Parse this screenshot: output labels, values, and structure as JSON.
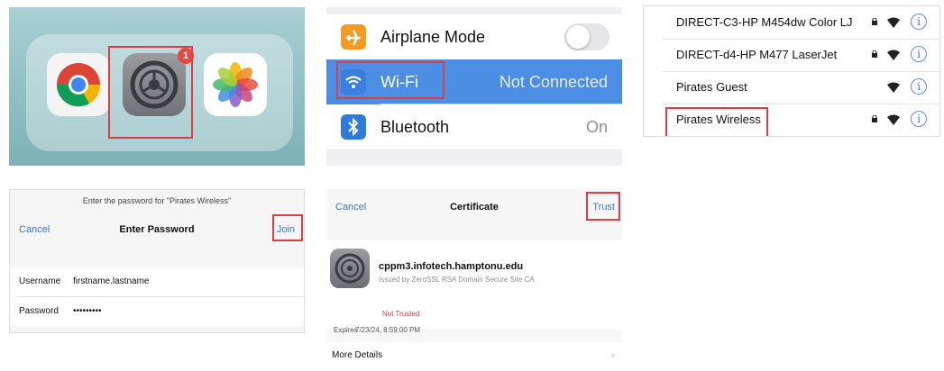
{
  "dock": {
    "badge": "1",
    "apps": [
      "chrome-icon",
      "settings-icon",
      "photos-icon"
    ]
  },
  "settings": {
    "airplane_label": "Airplane Mode",
    "wifi_label": "Wi-Fi",
    "wifi_value": "Not Connected",
    "bluetooth_label": "Bluetooth",
    "bluetooth_value": "On",
    "highlight_color": "#4d8ee5"
  },
  "networks": [
    {
      "name": "DIRECT-C3-HP M454dw Color LJ",
      "locked": true
    },
    {
      "name": "DIRECT-d4-HP M477 LaserJet",
      "locked": true
    },
    {
      "name": "Pirates Guest",
      "locked": false
    },
    {
      "name": "Pirates Wireless",
      "locked": true
    }
  ],
  "password_dialog": {
    "hint": "Enter the password for \"Pirates Wireless\"",
    "cancel": "Cancel",
    "title": "Enter Password",
    "join": "Join",
    "username_label": "Username",
    "username_value": "firstname.lastname",
    "password_label": "Password",
    "password_value": "•••••••••"
  },
  "certificate": {
    "cancel": "Cancel",
    "title": "Certificate",
    "trust": "Trust",
    "host": "cppm3.infotech.hamptonu.edu",
    "issued_by": "Issued by ZeroSSL RSA Domain Secure Site CA",
    "status": "Not Trusted",
    "expires_label": "Expires",
    "expires_value": "7/23/24, 8:59:00 PM",
    "more_details": "More Details",
    "chevron": "›"
  }
}
